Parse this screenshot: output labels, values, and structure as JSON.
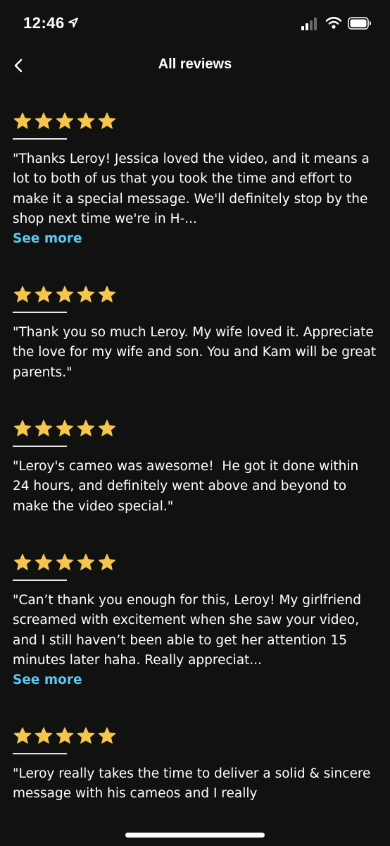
{
  "status_bar": {
    "time": "12:46",
    "icons": [
      "location-arrow-icon",
      "signal-bars-icon",
      "wifi-icon",
      "battery-icon"
    ]
  },
  "header": {
    "back_icon": "chevron-left-icon",
    "title": "All reviews"
  },
  "colors": {
    "background": "#111111",
    "star": "#f5c54d",
    "link": "#5ec6ee"
  },
  "reviews": [
    {
      "rating": 5,
      "text": "\"Thanks Leroy! Jessica loved the video, and it means a lot to both of us that you took the time and effort to make it a special message. We'll definitely stop by the shop next time we're in H-...",
      "see_more": "See more"
    },
    {
      "rating": 5,
      "text": "\"Thank you so much Leroy. My wife loved it. Appreciate the love for my wife and son. You and Kam will be great parents.\""
    },
    {
      "rating": 5,
      "text": "\"Leroy's cameo was awesome!  He got it done within 24 hours, and definitely went above and beyond to make the video special.\""
    },
    {
      "rating": 5,
      "text": "\"Can’t thank you enough for this, Leroy! My girlfriend screamed with excitement when she saw your video, and I still haven’t been able to get her attention 15 minutes later haha. Really appreciat...",
      "see_more": "See more"
    },
    {
      "rating": 5,
      "text": "\"Leroy really takes the time to deliver a solid & sincere message with his cameos and I really"
    }
  ]
}
